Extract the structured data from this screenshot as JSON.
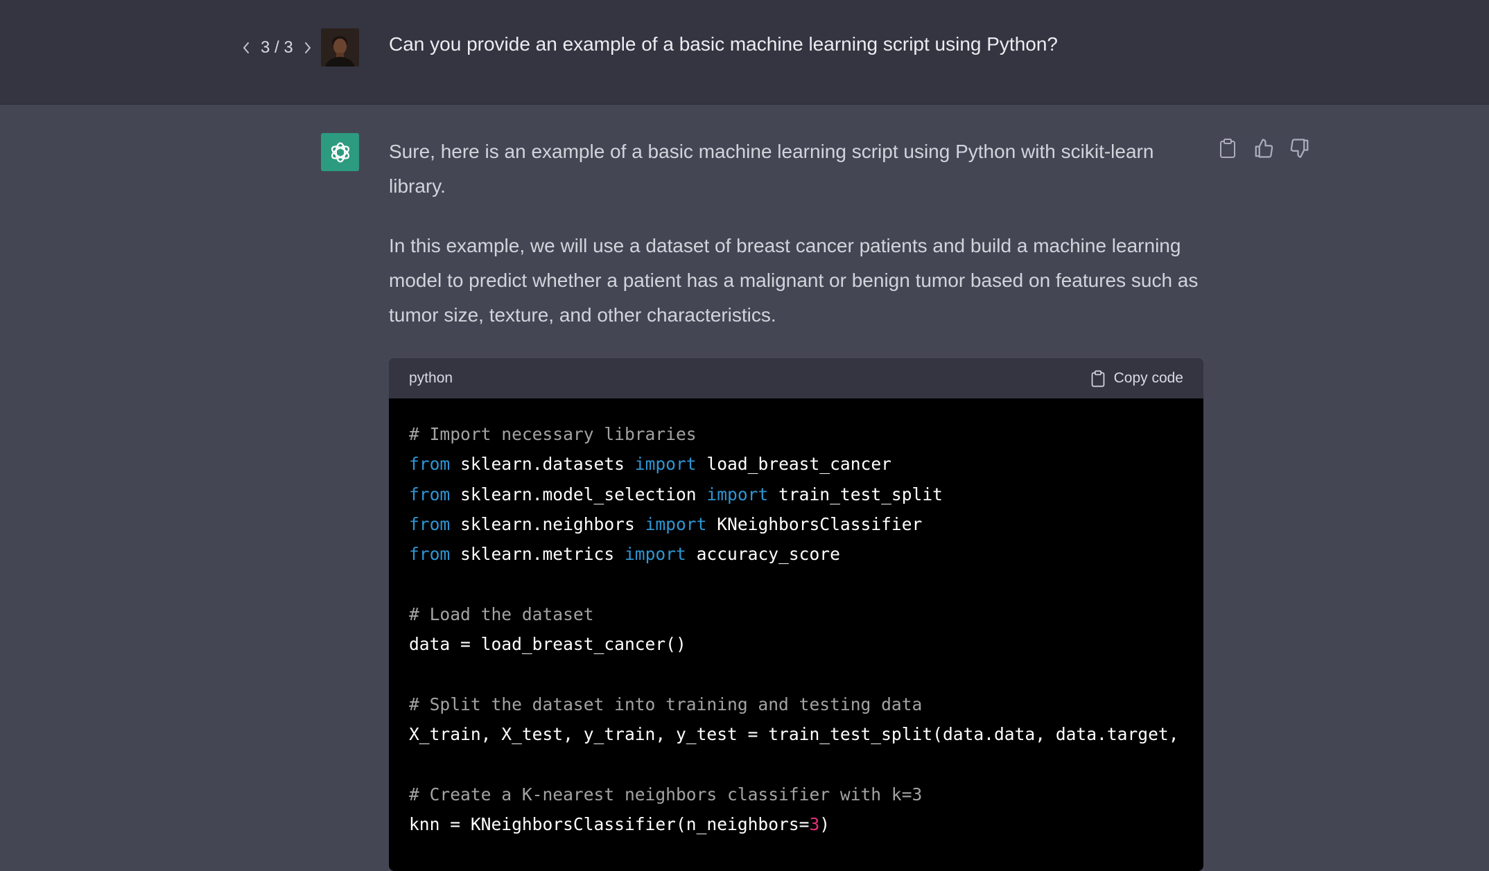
{
  "user_message": {
    "pager": {
      "current": "3",
      "total": "3",
      "separator": " / "
    },
    "text": "Can you provide an example of a basic machine learning script using Python?"
  },
  "assistant_message": {
    "paragraphs": [
      "Sure, here is an example of a basic machine learning script using Python with scikit-learn library.",
      "In this example, we will use a dataset of breast cancer patients and build a machine learning model to predict whether a patient has a malignant or benign tumor based on features such as tumor size, texture, and other characteristics."
    ],
    "actions": [
      "clipboard-icon",
      "thumbs-up-icon",
      "thumbs-down-icon"
    ]
  },
  "code_block": {
    "language": "python",
    "copy_label": "Copy code",
    "lines": [
      [
        {
          "t": "comment",
          "v": "# Import necessary libraries"
        }
      ],
      [
        {
          "t": "kw",
          "v": "from"
        },
        {
          "t": "plain",
          "v": " sklearn.datasets "
        },
        {
          "t": "kw",
          "v": "import"
        },
        {
          "t": "plain",
          "v": " load_breast_cancer"
        }
      ],
      [
        {
          "t": "kw",
          "v": "from"
        },
        {
          "t": "plain",
          "v": " sklearn.model_selection "
        },
        {
          "t": "kw",
          "v": "import"
        },
        {
          "t": "plain",
          "v": " train_test_split"
        }
      ],
      [
        {
          "t": "kw",
          "v": "from"
        },
        {
          "t": "plain",
          "v": " sklearn.neighbors "
        },
        {
          "t": "kw",
          "v": "import"
        },
        {
          "t": "plain",
          "v": " KNeighborsClassifier"
        }
      ],
      [
        {
          "t": "kw",
          "v": "from"
        },
        {
          "t": "plain",
          "v": " sklearn.metrics "
        },
        {
          "t": "kw",
          "v": "import"
        },
        {
          "t": "plain",
          "v": " accuracy_score"
        }
      ],
      [],
      [
        {
          "t": "comment",
          "v": "# Load the dataset"
        }
      ],
      [
        {
          "t": "plain",
          "v": "data = load_breast_cancer()"
        }
      ],
      [],
      [
        {
          "t": "comment",
          "v": "# Split the dataset into training and testing data"
        }
      ],
      [
        {
          "t": "plain",
          "v": "X_train, X_test, y_train, y_test = train_test_split(data.data, data.target,"
        }
      ],
      [],
      [
        {
          "t": "comment",
          "v": "# Create a K-nearest neighbors classifier with k=3"
        }
      ],
      [
        {
          "t": "plain",
          "v": "knn = KNeighborsClassifier(n_neighbors="
        },
        {
          "t": "num",
          "v": "3"
        },
        {
          "t": "plain",
          "v": ")"
        }
      ]
    ]
  },
  "colors": {
    "page_bg": "#444654",
    "user_row_bg": "#343541",
    "code_bg": "#000000",
    "code_header_bg": "#343541",
    "keyword": "#2e95d3",
    "comment": "#a3a3a3",
    "number": "#df3079",
    "bot_avatar_bg": "#10a37f"
  }
}
